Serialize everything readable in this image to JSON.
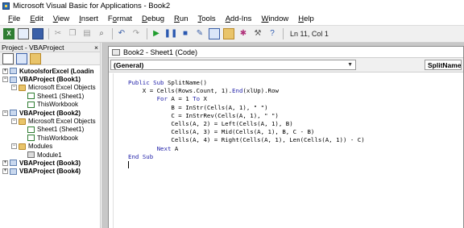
{
  "window": {
    "title": "Microsoft Visual Basic for Applications - Book2"
  },
  "menubar": {
    "items": [
      {
        "key": "F",
        "rest": "ile"
      },
      {
        "key": "E",
        "rest": "dit"
      },
      {
        "key": "V",
        "rest": "iew"
      },
      {
        "key": "I",
        "rest": "nsert"
      },
      {
        "pre": "F",
        "key": "o",
        "rest": "rmat"
      },
      {
        "key": "D",
        "rest": "ebug"
      },
      {
        "key": "R",
        "rest": "un"
      },
      {
        "key": "T",
        "rest": "ools"
      },
      {
        "key": "A",
        "rest": "dd-Ins"
      },
      {
        "key": "W",
        "rest": "indow"
      },
      {
        "key": "H",
        "rest": "elp"
      }
    ]
  },
  "toolbar": {
    "icons": [
      "excel-icon",
      "insert-userform-icon",
      "save-icon",
      "cut-icon",
      "copy-icon",
      "paste-icon",
      "find-icon",
      "undo-icon",
      "redo-icon",
      "run-icon",
      "break-icon",
      "reset-icon",
      "design-mode-icon",
      "project-explorer-icon",
      "properties-icon",
      "object-browser-icon",
      "toolbox-icon",
      "help-icon"
    ],
    "status": "Ln 11, Col 1"
  },
  "project_panel": {
    "title": "Project - VBAProject",
    "close": "×",
    "tree": [
      {
        "indent": 0,
        "exp": "+",
        "icon": "project",
        "label": "KutoolsforExcel (Loadin",
        "bold": true
      },
      {
        "indent": 0,
        "exp": "−",
        "icon": "project",
        "label": "VBAProject (Book1)",
        "bold": true
      },
      {
        "indent": 1,
        "exp": "−",
        "icon": "folder",
        "label": "Microsoft Excel Objects",
        "bold": false
      },
      {
        "indent": 2,
        "exp": "",
        "icon": "sheet",
        "label": "Sheet1 (Sheet1)",
        "bold": false
      },
      {
        "indent": 2,
        "exp": "",
        "icon": "wb",
        "label": "ThisWorkbook",
        "bold": false
      },
      {
        "indent": 0,
        "exp": "−",
        "icon": "project",
        "label": "VBAProject (Book2)",
        "bold": true
      },
      {
        "indent": 1,
        "exp": "−",
        "icon": "folder",
        "label": "Microsoft Excel Objects",
        "bold": false
      },
      {
        "indent": 2,
        "exp": "",
        "icon": "sheet",
        "label": "Sheet1 (Sheet1)",
        "bold": false
      },
      {
        "indent": 2,
        "exp": "",
        "icon": "wb",
        "label": "ThisWorkbook",
        "bold": false
      },
      {
        "indent": 1,
        "exp": "−",
        "icon": "folder",
        "label": "Modules",
        "bold": false
      },
      {
        "indent": 2,
        "exp": "",
        "icon": "mod",
        "label": "Module1",
        "bold": false
      },
      {
        "indent": 0,
        "exp": "+",
        "icon": "project",
        "label": "VBAProject (Book3)",
        "bold": true
      },
      {
        "indent": 0,
        "exp": "+",
        "icon": "project",
        "label": "VBAProject (Book4)",
        "bold": true
      }
    ]
  },
  "code_window": {
    "title": "Book2 - Sheet1 (Code)",
    "object_dropdown": "(General)",
    "procedure_dropdown": "SplitName",
    "lines": [
      "Public Sub SplitName()",
      "    X = Cells(Rows.Count, 1).End(xlUp).Row",
      "        For A = 1 To X",
      "            B = InStr(Cells(A, 1), \" \")",
      "            C = InStrRev(Cells(A, 1), \" \")",
      "            Cells(A, 2) = Left(Cells(A, 1), B)",
      "            Cells(A, 3) = Mid(Cells(A, 1), B, C - B)",
      "            Cells(A, 4) = Right(Cells(A, 1), Len(Cells(A, 1)) - C)",
      "        Next A",
      "End Sub",
      ""
    ]
  },
  "colors": {
    "keyword": "#1f1fa8",
    "mdi_background": "#c8c8c8",
    "toolbar": "#f0f0f0"
  }
}
